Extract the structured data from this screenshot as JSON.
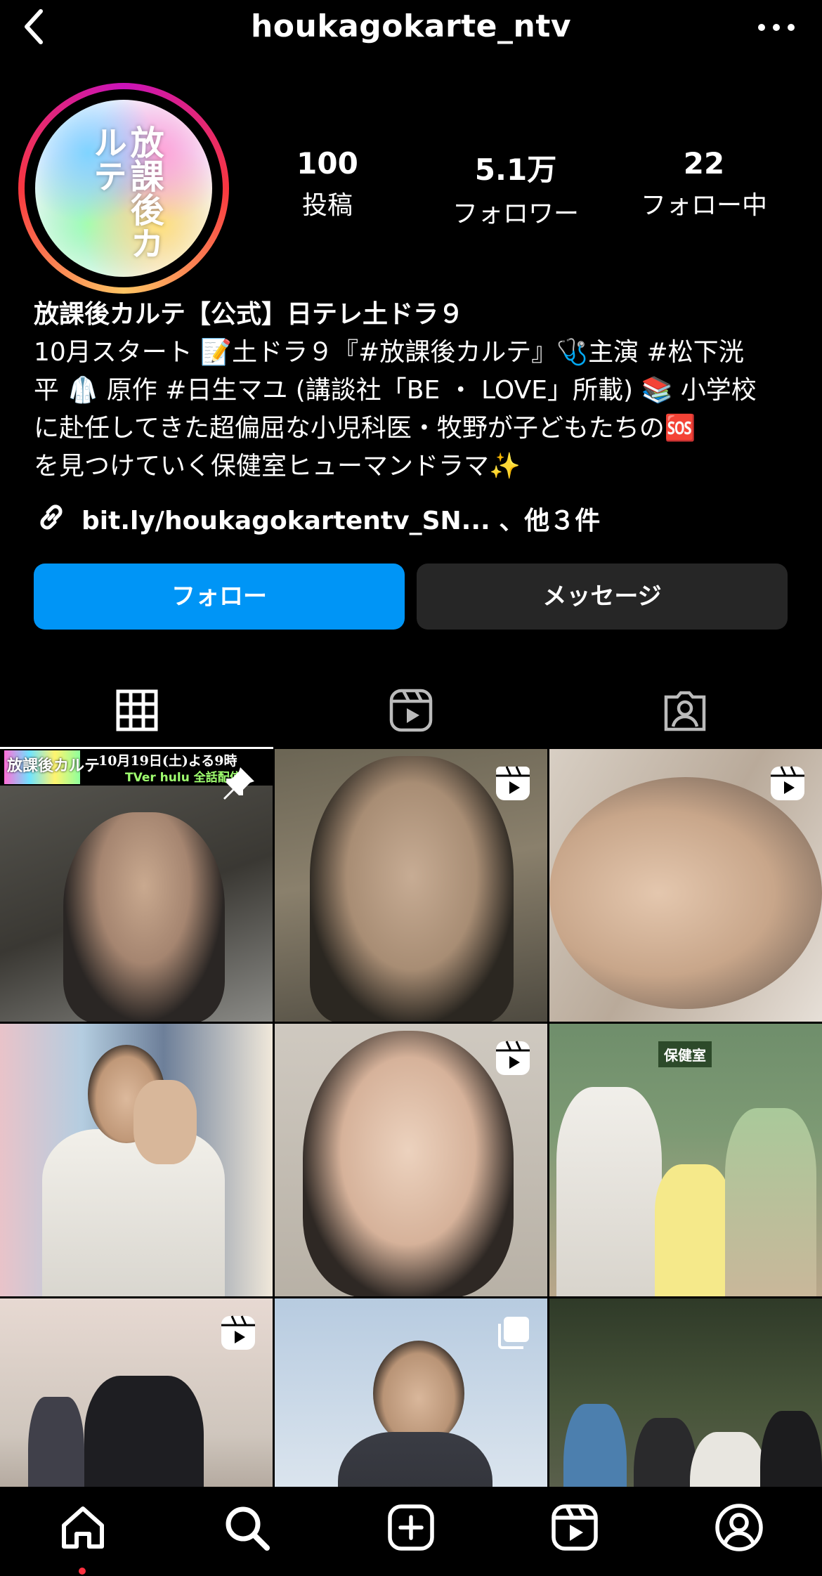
{
  "header": {
    "username": "houkagokarte_ntv"
  },
  "profile": {
    "avatar_text": "放課後カルテ",
    "stats": [
      {
        "value": "100",
        "label": "投稿"
      },
      {
        "value": "5.1万",
        "label": "フォロワー"
      },
      {
        "value": "22",
        "label": "フォロー中"
      }
    ],
    "display_name": "放課後カルテ【公式】日テレ土ドラ９",
    "bio_lines": [
      "10月スタート 📝土ドラ９『#放課後カルテ』🩺主演 #松下洸",
      "平 🥼 原作 #日生マユ (講談社「BE ・ LOVE」所載) 📚 小学校",
      "に赴任してきた超偏屈な小児科医・牧野が子どもたちの🆘",
      "を見つけていく保健室ヒューマンドラマ✨"
    ],
    "link_text": "bit.ly/houkagokartentv_SN... 、他３件"
  },
  "actions": {
    "follow_label": "フォロー",
    "message_label": "メッセージ"
  },
  "tabs": [
    {
      "icon": "grid-icon",
      "active": true
    },
    {
      "icon": "reels-icon",
      "active": false
    },
    {
      "icon": "tagged-icon",
      "active": false
    }
  ],
  "grid": {
    "first_post_banner": {
      "title": "放課後カルテ",
      "air_info": "10月19日(土)よる9時",
      "stream": "TVer hulu 全話配信"
    },
    "posts": [
      {
        "type": "pinned",
        "caption": ""
      },
      {
        "type": "reel",
        "caption": ""
      },
      {
        "type": "reel",
        "caption": ""
      },
      {
        "type": "photo",
        "caption": ""
      },
      {
        "type": "reel",
        "caption": ""
      },
      {
        "type": "photo",
        "caption": "保健室"
      },
      {
        "type": "reel",
        "caption": ""
      },
      {
        "type": "carousel",
        "caption": ""
      },
      {
        "type": "photo",
        "caption": ""
      }
    ]
  },
  "nav": [
    "home-icon",
    "search-icon",
    "create-icon",
    "reels-icon",
    "profile-icon"
  ],
  "colors": {
    "accent": "#0095f6",
    "message_button": "#262626",
    "background": "#000000"
  }
}
